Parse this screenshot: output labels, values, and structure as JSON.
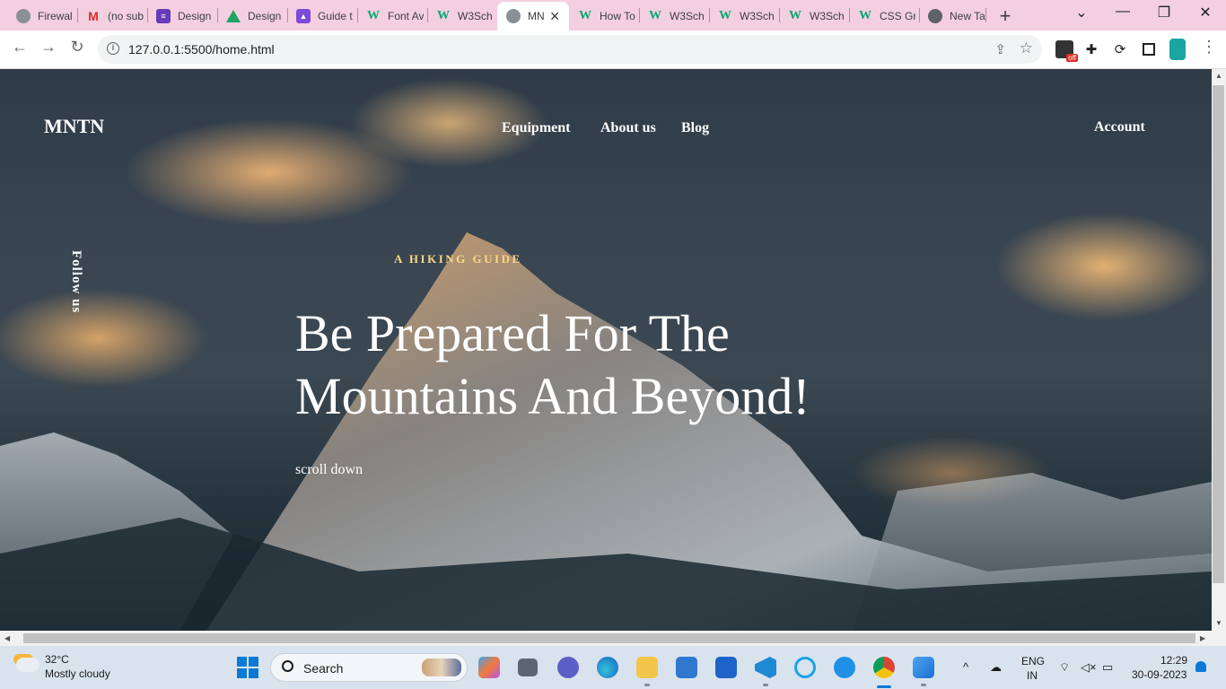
{
  "browser": {
    "tabs": [
      {
        "title": "Firewal",
        "favicon": "globe-icon"
      },
      {
        "title": "(no sub",
        "favicon": "gmail-icon"
      },
      {
        "title": "Design",
        "favicon": "forms-icon"
      },
      {
        "title": "Design",
        "favicon": "drive-icon"
      },
      {
        "title": "Guide t",
        "favicon": "guide-icon"
      },
      {
        "title": "Font Av",
        "favicon": "w3schools-icon"
      },
      {
        "title": "W3Sch",
        "favicon": "w3schools-icon"
      },
      {
        "title": "MN",
        "favicon": "globe-icon",
        "active": true
      },
      {
        "title": "How To",
        "favicon": "w3schools-icon"
      },
      {
        "title": "W3Sch",
        "favicon": "w3schools-icon"
      },
      {
        "title": "W3Sch",
        "favicon": "w3schools-icon"
      },
      {
        "title": "W3Sch",
        "favicon": "w3schools-icon"
      },
      {
        "title": "CSS Gr",
        "favicon": "w3schools-icon"
      },
      {
        "title": "New Ta",
        "favicon": "chrome-icon"
      }
    ],
    "url": "127.0.0.1:5500/home.html",
    "extension_badge": "off"
  },
  "site": {
    "logo": "MNTN",
    "nav": [
      "Equipment",
      "About us",
      "Blog"
    ],
    "account": "Account",
    "follow": "Follow us",
    "kicker": "A HIKING GUIDE",
    "headline_line1": "Be Prepared For The",
    "headline_line2": "Mountains And Beyond!",
    "scroll": "scroll down",
    "accent_color": "#fbd784"
  },
  "taskbar": {
    "temperature": "32°C",
    "weather": "Mostly cloudy",
    "search_placeholder": "Search",
    "language": "ENG",
    "region": "IN",
    "time": "12:29",
    "date": "30-09-2023"
  }
}
